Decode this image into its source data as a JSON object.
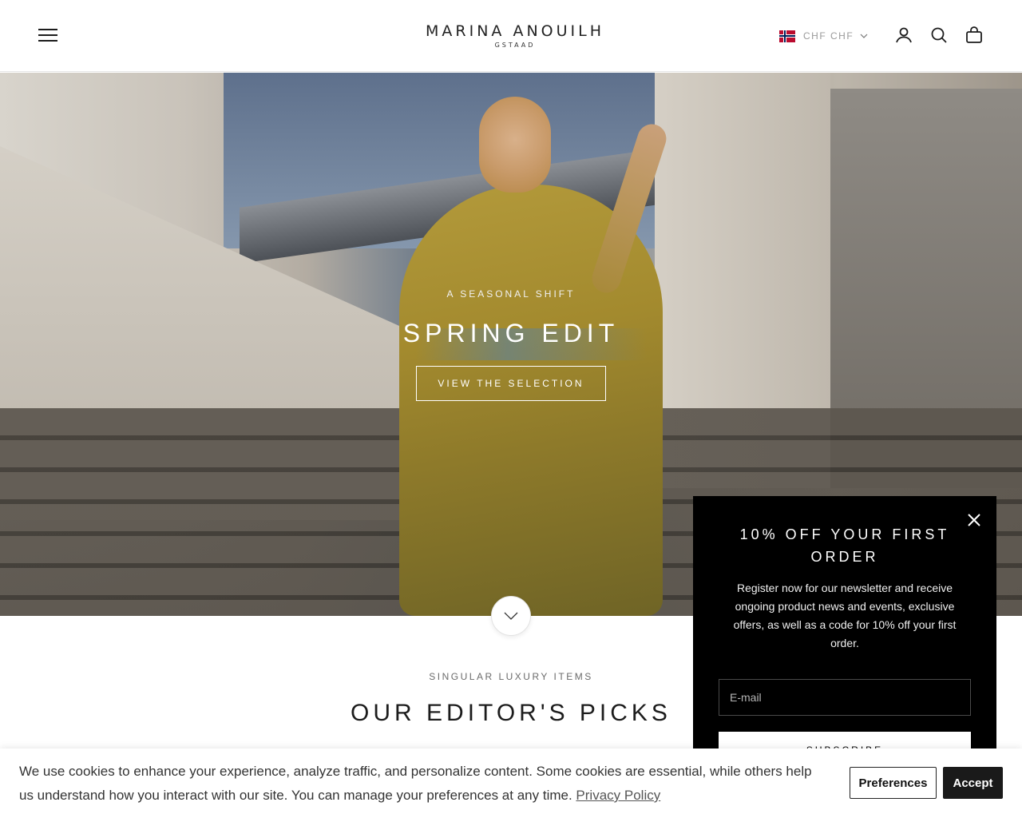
{
  "header": {
    "logo_main": "MARINA ANOUILH",
    "logo_sub": "GSTAAD",
    "currency_label": "CHF CHF",
    "menu_icon": "hamburger-menu-icon",
    "account_icon": "user-icon",
    "search_icon": "search-icon",
    "cart_icon": "shopping-bag-icon"
  },
  "hero": {
    "kicker": "A SEASONAL SHIFT",
    "title": "SPRING EDIT",
    "cta": "VIEW THE SELECTION"
  },
  "picks": {
    "kicker": "SINGULAR LUXURY ITEMS",
    "title": "OUR EDITOR'S PICKS"
  },
  "newsletter": {
    "title": "10% OFF YOUR FIRST ORDER",
    "text": "Register now for our newsletter and receive ongoing product news and events, exclusive offers, as well as a code for 10% off your first order.",
    "email_placeholder": "E-mail",
    "submit_label": "SUBSCRIBE"
  },
  "cookie": {
    "text": "We use cookies to enhance your experience, analyze traffic, and personalize content. Some cookies are essential, while others help us understand how you interact with our site. You can manage your preferences at any time.",
    "policy_link": "Privacy Policy",
    "preferences_label": "Preferences",
    "accept_label": "Accept"
  },
  "colors": {
    "popup_bg": "#000000",
    "accept_bg": "#1a1a1a",
    "text_dark": "#1c1c1c"
  }
}
